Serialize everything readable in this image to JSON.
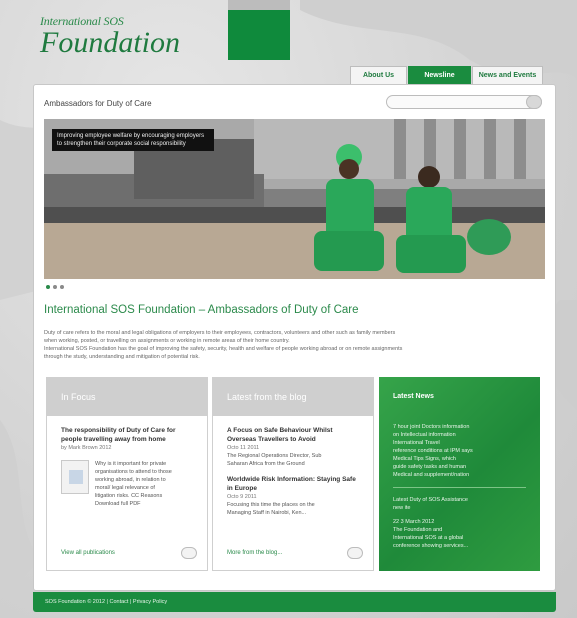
{
  "brand": {
    "small": "International SOS",
    "large": "Foundation"
  },
  "tabs": [
    {
      "label": "About Us"
    },
    {
      "label": "Newsline"
    },
    {
      "label": "News and Events"
    }
  ],
  "page": {
    "title": "Ambassadors for Duty of Care",
    "hero_caption": "Improving employee welfare by encouraging employers to strengthen their corporate social responsibility",
    "headline": "International SOS Foundation – Ambassadors of Duty of Care",
    "body_lines": [
      "Duty of care refers to the moral and legal obligations of employers to their employees, contractors, volunteers and other such as family members",
      "when working, posted, or travelling on assignments or working in remote areas of their home country.",
      "International SOS Foundation has the goal of improving the safety, security, health and welfare of people working abroad or on remote assignments",
      "through the study, understanding and mitigation of potential risk."
    ]
  },
  "columns": {
    "publications": {
      "title": "In Focus",
      "item_title": "The responsibility of Duty of Care for people travelling away from home",
      "item_meta": "by Mark Brown 2012",
      "item_text": [
        "Why is it important for private",
        "organisations to attend to those",
        "working abroad, in relation to",
        "moral/ legal relevance of",
        "litigation risks. CC Reasons",
        "Download full PDF"
      ],
      "link": "View all publications"
    },
    "blog": {
      "title": "Latest from the blog",
      "posts": [
        {
          "title": "A Focus on Safe Behaviour Whilst Overseas Travellers to Avoid",
          "meta": "Octo 11 2011",
          "text": [
            "The Regional Operations Director, Sub",
            "Saharan Africa from the Ground"
          ]
        },
        {
          "title": "Worldwide Risk Information: Staying Safe in Europe",
          "meta": "Octo 9 2011",
          "text": [
            "Focusing this time the places on the",
            "Managing Staff in Nairobi, Ken..."
          ]
        }
      ],
      "link": "More from the blog..."
    },
    "latest": {
      "title": "Latest News",
      "paragraphs": [
        [
          "7 hour joint Doctors information",
          "on Intellectual information",
          "International Travel",
          "reference conditions at IPM says",
          "Medical Tips Signs, which",
          "guide safety tasks and human",
          "Medical and supplement/nation"
        ],
        [
          "Latest Duty of SOS Assistance",
          "new ite"
        ],
        [
          "22 3 March 2012",
          "The Foundation and",
          "International SOS at a global",
          "conference showing services..."
        ]
      ]
    }
  },
  "footer": {
    "text": "SOS Foundation © 2012 | Contact | Privacy Policy"
  },
  "colors": {
    "brand_green": "#1a8c3f",
    "accent_green": "#2a8a4a",
    "background_grey": "#d9d9d9"
  }
}
